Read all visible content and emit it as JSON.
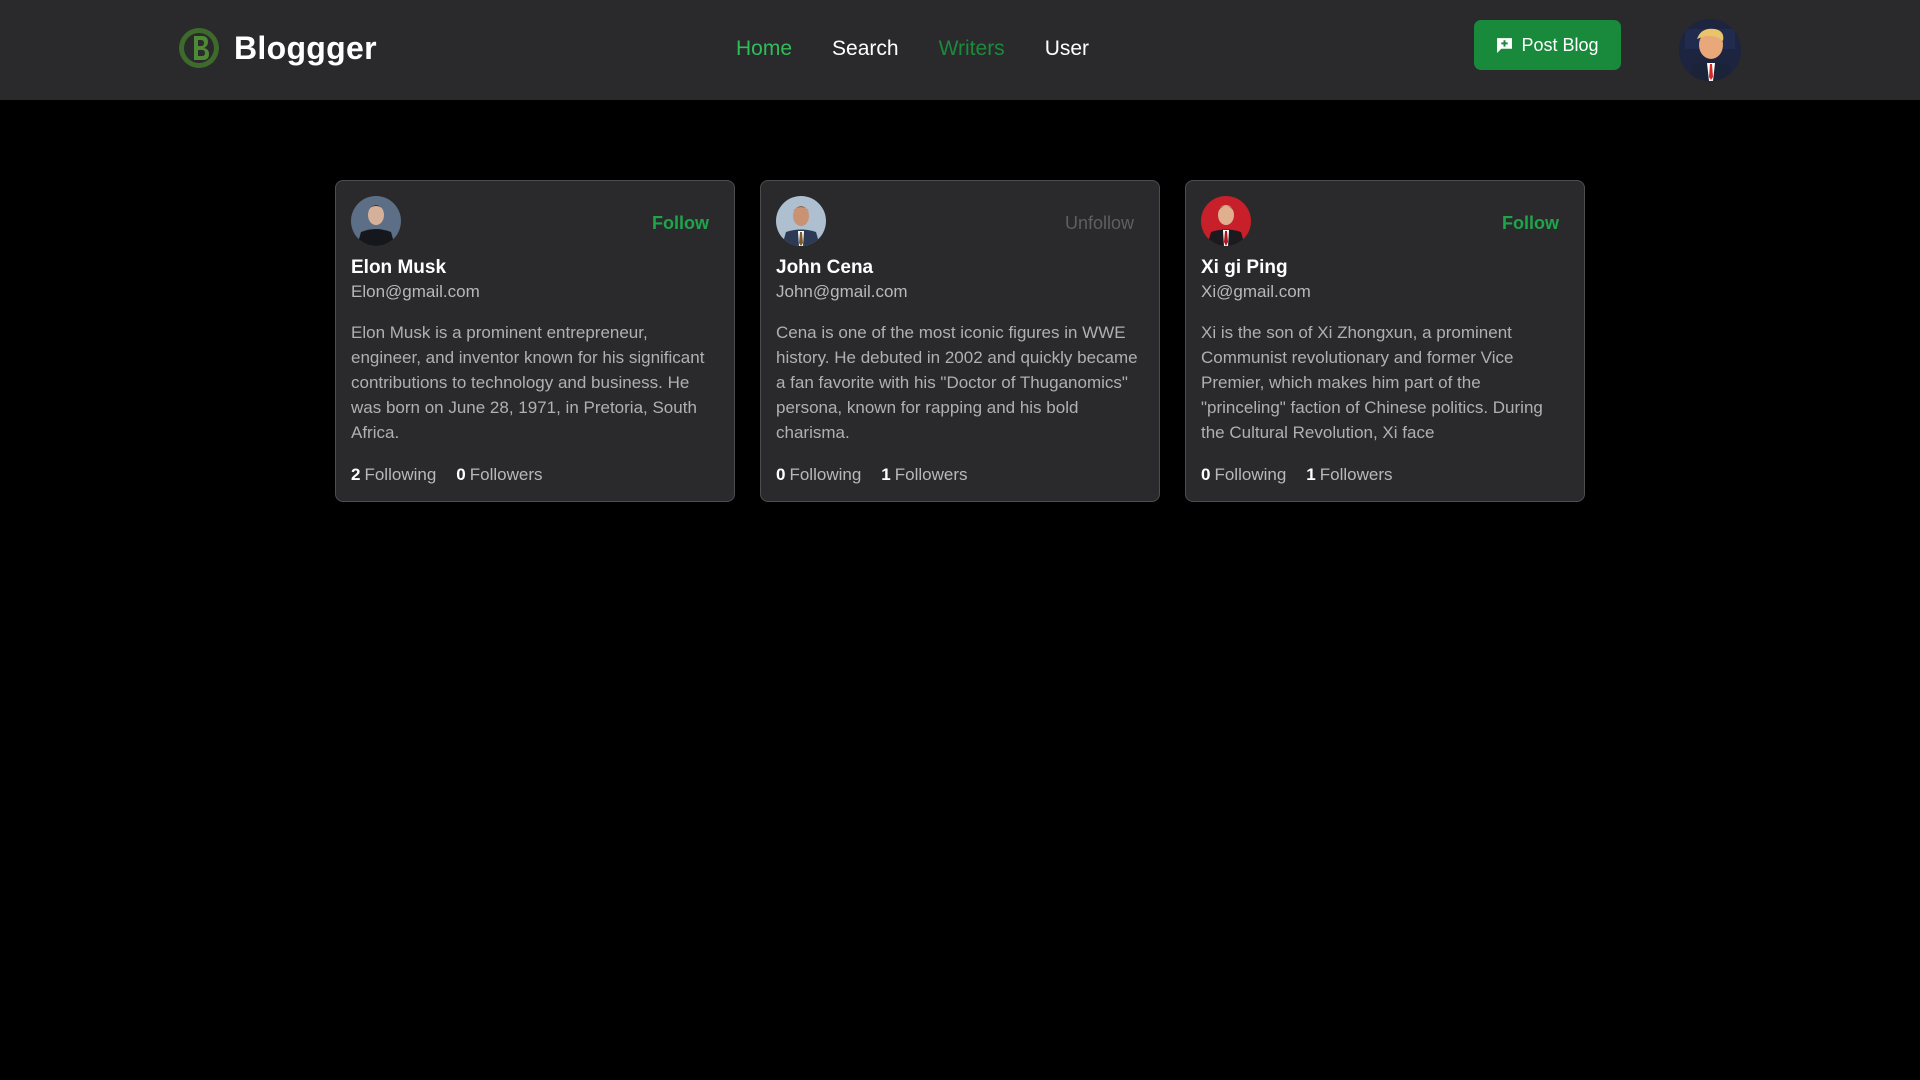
{
  "app": {
    "brand_name": "Bloggger",
    "nav": [
      {
        "label": "Home"
      },
      {
        "label": "Search"
      },
      {
        "label": "Writers"
      },
      {
        "label": "User"
      }
    ],
    "post_button_label": "Post Blog",
    "colors": {
      "accent_green": "#2ebd59",
      "button_green": "#198a3c",
      "card_bg": "#2a2a2c",
      "page_bg": "#000000"
    }
  },
  "writers": [
    {
      "name": "Elon Musk",
      "email": "Elon@gmail.com",
      "bio": "Elon Musk is a prominent entrepreneur, engineer, and inventor known for his significant contributions to technology and business. He was born on June 28, 1971, in Pretoria, South Africa.",
      "follow_label": "Follow",
      "following_count": "2",
      "following_label": "Following",
      "followers_count": "0",
      "followers_label": "Followers",
      "avatar_icon": "person-avatar-icon"
    },
    {
      "name": "John Cena",
      "email": "John@gmail.com",
      "bio": "Cena is one of the most iconic figures in WWE history. He debuted in 2002 and quickly became a fan favorite with his \"Doctor of Thuganomics\" persona, known for rapping and his bold charisma.",
      "follow_label": "Unfollow",
      "following_count": "0",
      "following_label": "Following",
      "followers_count": "1",
      "followers_label": "Followers",
      "avatar_icon": "person-avatar-icon"
    },
    {
      "name": "Xi gi Ping",
      "email": "Xi@gmail.com",
      "bio": "Xi is the son of Xi Zhongxun, a prominent Communist revolutionary and former Vice Premier, which makes him part of the \"princeling\" faction of Chinese politics. During the Cultural Revolution, Xi face",
      "follow_label": "Follow",
      "following_count": "0",
      "following_label": "Following",
      "followers_count": "1",
      "followers_label": "Followers",
      "avatar_icon": "person-avatar-icon"
    }
  ]
}
